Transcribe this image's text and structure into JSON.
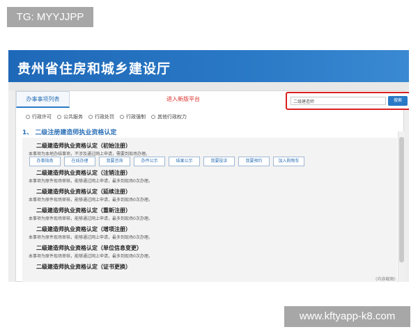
{
  "watermarks": {
    "top": "TG: MYYJJPP",
    "bottom": "www.kftyapp-k8.com"
  },
  "header": {
    "title": "贵州省住房和城乡建设厅"
  },
  "tabs": {
    "list_label": "办事事项列表",
    "new_label": "进入新版平台"
  },
  "search": {
    "value": "二级建造师",
    "button_label": "搜索"
  },
  "filters": [
    "行政许可",
    "公共服务",
    "行政处罚",
    "行政强制",
    "其他行政权力"
  ],
  "section": {
    "title": "1、 二级注册建造师执业资格认定"
  },
  "items": [
    {
      "title": "二级建造师执业资格认定（初始注册）",
      "desc": "本事项为本地办结事项，不涉及通过网上申请，需要到现场办理。"
    },
    {
      "title": "二级建造师执业资格认定（注销注册）",
      "desc": "本事项为原件现场审核，能够通过网上申请，最多到现场0次办理。"
    },
    {
      "title": "二级建造师执业资格认定（延续注册）",
      "desc": "本事项为原件现场审核，能够通过网上申请，最多到现场0次办理。"
    },
    {
      "title": "二级建造师执业资格认定（重新注册）",
      "desc": "本事项为原件现场审核，能够通过网上申请，最多到现场0次办理。"
    },
    {
      "title": "二级建造师执业资格认定（增项注册）",
      "desc": "本事项为原件现场审核，能够通过网上申请，最多到现场0次办理。"
    },
    {
      "title": "二级建造师执业资格认定（单位信息变更）",
      "desc": "本事项为原件现场审核，能够通过网上申请，最多到现场0次办理。"
    },
    {
      "title": "二级建造师执业资格认定（证书更换）",
      "desc": ""
    }
  ],
  "action_buttons": [
    "办事指南",
    "在线办理",
    "我要咨询",
    "办件公示",
    "结果公示",
    "我要投诉",
    "我要预约",
    "加入购物车"
  ],
  "footer": {
    "zoom_note": "(内容截图)"
  },
  "colors": {
    "banner": "#2a79c6",
    "accent_red": "#d9201f",
    "link_blue": "#2a6fb6"
  }
}
